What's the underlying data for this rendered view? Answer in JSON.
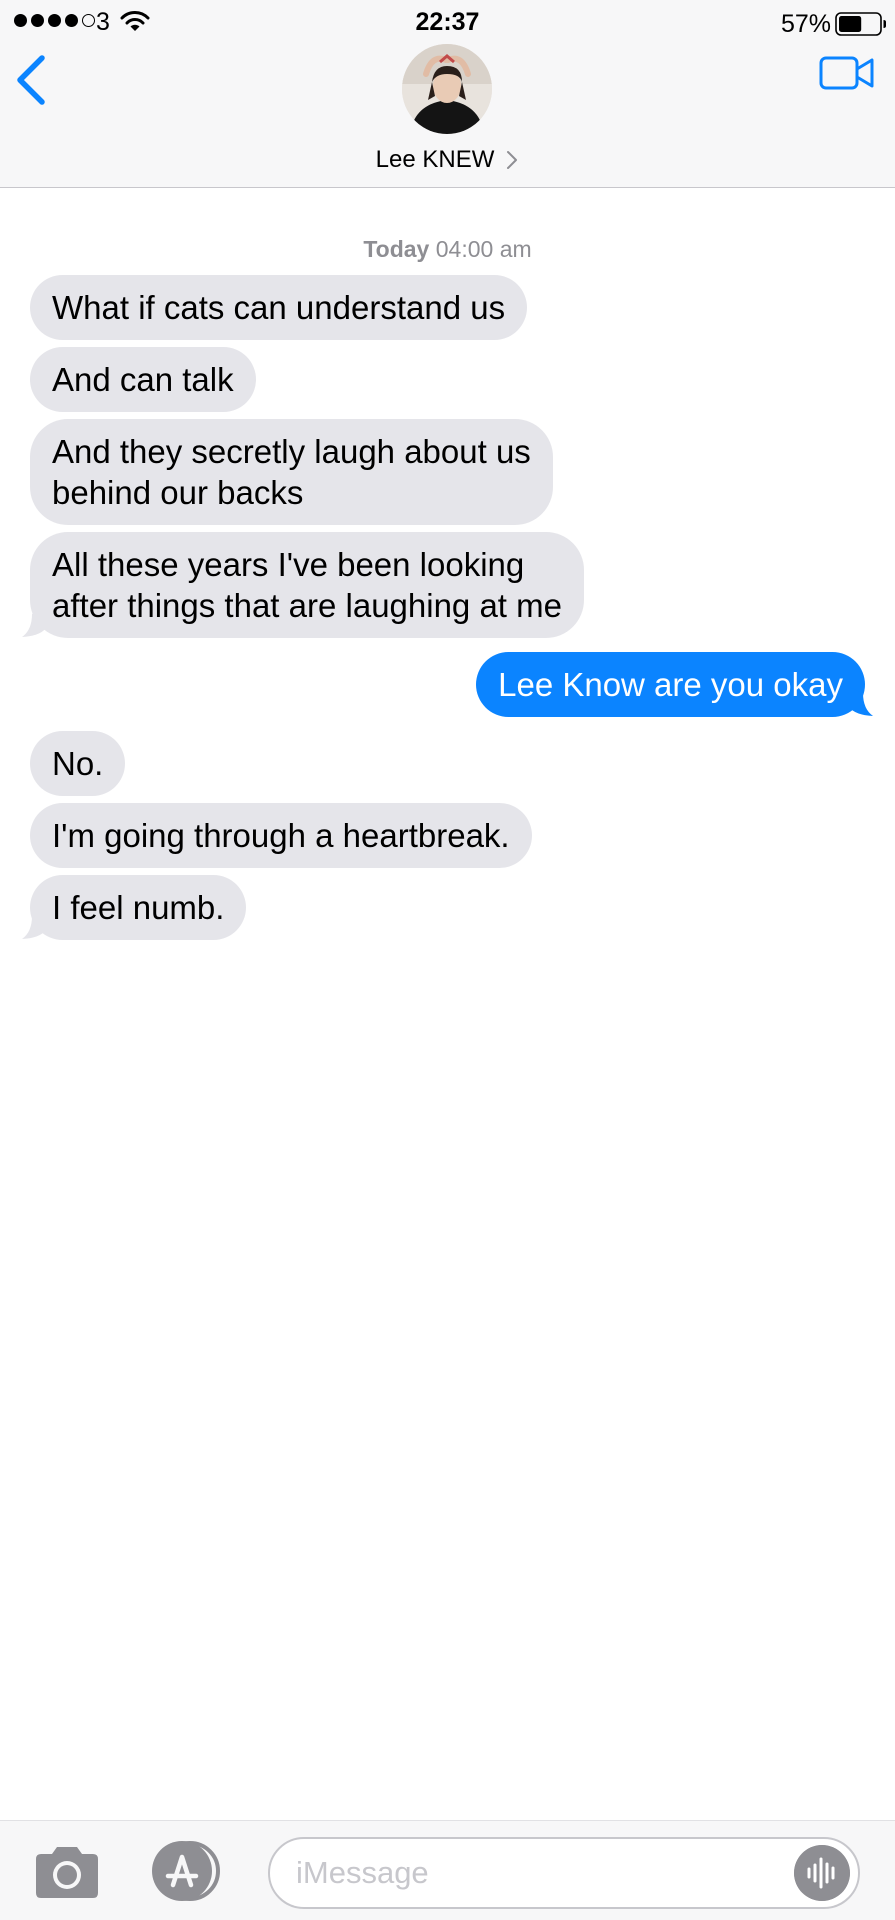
{
  "status_bar": {
    "carrier": "3",
    "time": "22:37",
    "battery_percent": "57%",
    "battery_level": 0.57,
    "signal_bars_filled": 4,
    "signal_bars_total": 5
  },
  "header": {
    "contact_name": "Lee KNEW"
  },
  "thread": {
    "timestamp_day": "Today",
    "timestamp_time": " 04:00 am",
    "messages": [
      {
        "direction": "incoming",
        "lines": [
          "What if cats can understand us"
        ]
      },
      {
        "direction": "incoming",
        "lines": [
          "And can talk"
        ]
      },
      {
        "direction": "incoming",
        "lines": [
          "And they secretly laugh about us",
          "behind our backs"
        ]
      },
      {
        "direction": "incoming",
        "lines": [
          "All these years I've been looking",
          "after things that are laughing at me"
        ]
      },
      {
        "direction": "outgoing",
        "lines": [
          "Lee Know are you okay"
        ]
      },
      {
        "direction": "incoming",
        "lines": [
          "No."
        ]
      },
      {
        "direction": "incoming",
        "lines": [
          "I'm going through a heartbreak."
        ]
      },
      {
        "direction": "incoming",
        "lines": [
          "I feel numb."
        ]
      }
    ]
  },
  "input_bar": {
    "placeholder": "iMessage"
  },
  "colors": {
    "accent": "#0b84ff",
    "incoming_bubble": "#e5e5ea",
    "outgoing_bubble": "#0b84ff",
    "timestamp": "#8e8e93"
  }
}
